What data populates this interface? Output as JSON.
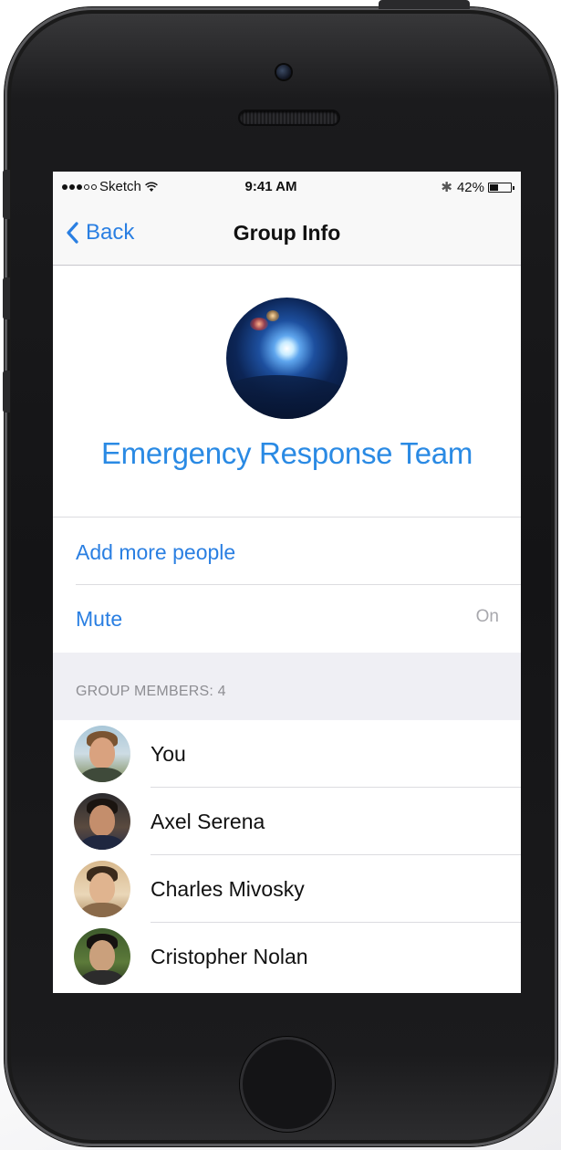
{
  "status_bar": {
    "carrier": "Sketch",
    "time": "9:41 AM",
    "battery_percent": "42%",
    "battery_level": 0.42,
    "signal_icon": "signal-dots-icon",
    "wifi_icon": "wifi-icon",
    "bluetooth_icon": "bluetooth-icon",
    "battery_icon": "battery-icon"
  },
  "nav": {
    "back_label": "Back",
    "back_icon": "chevron-left-icon",
    "title": "Group Info"
  },
  "group": {
    "name": "Emergency Response Team"
  },
  "actions": {
    "add_people": "Add more people",
    "mute_label": "Mute",
    "mute_value": "On"
  },
  "members_section": {
    "header": "GROUP MEMBERS: 4",
    "members": [
      {
        "name": "You"
      },
      {
        "name": "Axel Serena"
      },
      {
        "name": "Charles Mivosky"
      },
      {
        "name": "Cristopher Nolan"
      }
    ]
  },
  "colors": {
    "accent": "#2a7fe2",
    "group_name": "#2a8ae4",
    "secondary_text": "#a8a8ad",
    "section_background": "#efeff4"
  }
}
